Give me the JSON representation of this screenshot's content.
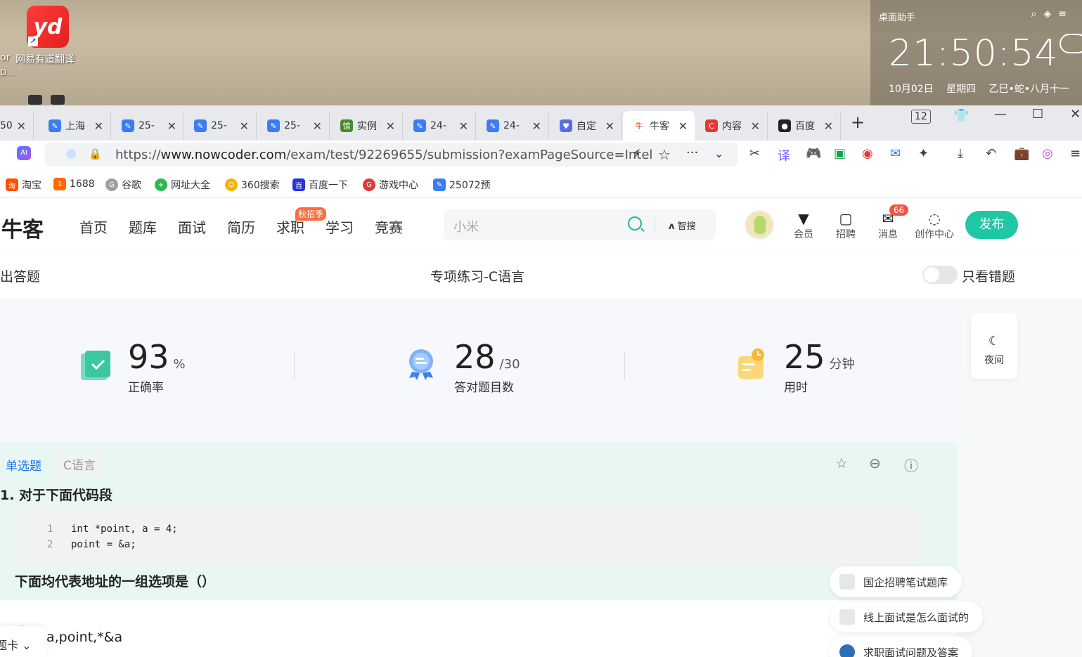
{
  "desktop": {
    "icon_text": "yd",
    "icon_label": "网易有道翻译",
    "partial_label": "or",
    "partial_label2": "D..."
  },
  "widget": {
    "title": "桌面助手",
    "time": "21:50:54",
    "date": "10月02日",
    "weekday": "星期四",
    "lunar": "乙巳•蛇•八月十一"
  },
  "tabs": [
    {
      "label": "50"
    },
    {
      "label": "上海"
    },
    {
      "label": "25-"
    },
    {
      "label": "25-"
    },
    {
      "label": "25-"
    },
    {
      "label": "实例"
    },
    {
      "label": "24-"
    },
    {
      "label": "24-"
    },
    {
      "label": "自定"
    },
    {
      "label": "牛客"
    },
    {
      "label": "内容"
    },
    {
      "label": "百度"
    }
  ],
  "window": {
    "tab_count": "12"
  },
  "address": {
    "url_prefix": "https://",
    "url_host": "www.nowcoder.com",
    "url_path": "/exam/test/92269655/submission?examPageSource=Intel"
  },
  "bookmarks": [
    {
      "label": "淘宝",
      "icon": "淘",
      "color": "#ff5000"
    },
    {
      "label": "1688",
      "icon": "1",
      "color": "#ff6a00"
    },
    {
      "label": "谷歌",
      "icon": "G",
      "color": "#9aa0a6"
    },
    {
      "label": "网址大全",
      "icon": "+",
      "color": "#2db84d"
    },
    {
      "label": "360搜索",
      "icon": "O",
      "color": "#f4b400"
    },
    {
      "label": "百度一下",
      "icon": "百",
      "color": "#2932e1"
    },
    {
      "label": "游戏中心",
      "icon": "G",
      "color": "#e53935"
    },
    {
      "label": "25072预",
      "icon": "✎",
      "color": "#3d7cf5"
    }
  ],
  "site": {
    "logo": "牛客",
    "nav": [
      "首页",
      "题库",
      "面试",
      "简历",
      "求职",
      "学习",
      "竞赛"
    ],
    "hot_badge": "秋招季",
    "search_placeholder": "小米",
    "ai_search": "智搜",
    "icons": [
      {
        "label": "会员",
        "icon": "vip-icon"
      },
      {
        "label": "招聘",
        "icon": "recruit-icon"
      },
      {
        "label": "消息",
        "icon": "message-icon"
      },
      {
        "label": "创作中心",
        "icon": "bulb-icon"
      }
    ],
    "message_count": "66",
    "publish": "发布"
  },
  "subheader": {
    "left": "出答题",
    "center": "专项练习-C语言",
    "toggle_label": "只看错题"
  },
  "stats": [
    {
      "value": "93",
      "unit": "%",
      "label": "正确率"
    },
    {
      "value": "28",
      "unit": "/30",
      "label": "答对题目数"
    },
    {
      "value": "25",
      "unit": "分钟",
      "label": "用时"
    }
  ],
  "night": {
    "label": "夜间"
  },
  "question": {
    "type": "单选题",
    "tag": "C语言",
    "title": "1. 对于下面代码段",
    "code": [
      {
        "ln": "1",
        "text": "int *point, a = 4;"
      },
      {
        "ln": "2",
        "text": "point = &a;"
      }
    ],
    "prompt": "下面均代表地址的一组选项是（）",
    "option_text": "a,point,*&a"
  },
  "answer_card": {
    "label": "题卡"
  },
  "floats": [
    {
      "label": "国企招聘笔试题库"
    },
    {
      "label": "线上面试是怎么面试的"
    },
    {
      "label": "求职面试问题及答案"
    }
  ]
}
